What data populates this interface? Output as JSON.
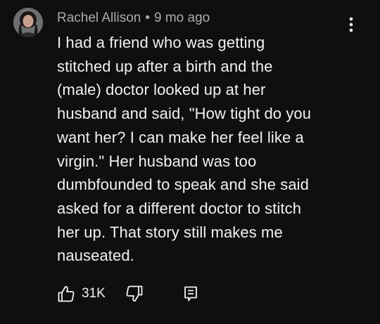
{
  "comment": {
    "author": "Rachel Allison",
    "separator": "•",
    "timestamp": "9 mo ago",
    "body_lines": [
      "I had a friend who was getting",
      "stitched up after a birth and the",
      "(male) doctor looked up at her",
      "husband and said, \"How tight do you",
      "want her? I can make her feel like a",
      "virgin.\" Her husband was too",
      "dumbfounded to speak and she said",
      "asked for a different doctor to stitch",
      "her up. That story still makes me",
      "nauseated."
    ],
    "like_count": "31K"
  },
  "icons": {
    "avatar": "avatar-photo",
    "more": "more-vertical-icon",
    "like": "thumbs-up-icon",
    "dislike": "thumbs-down-icon",
    "reply": "reply-comment-icon"
  },
  "colors": {
    "background": "#0f0f0f",
    "text": "#f1f1f1",
    "secondary_text": "#aaaaaa"
  }
}
